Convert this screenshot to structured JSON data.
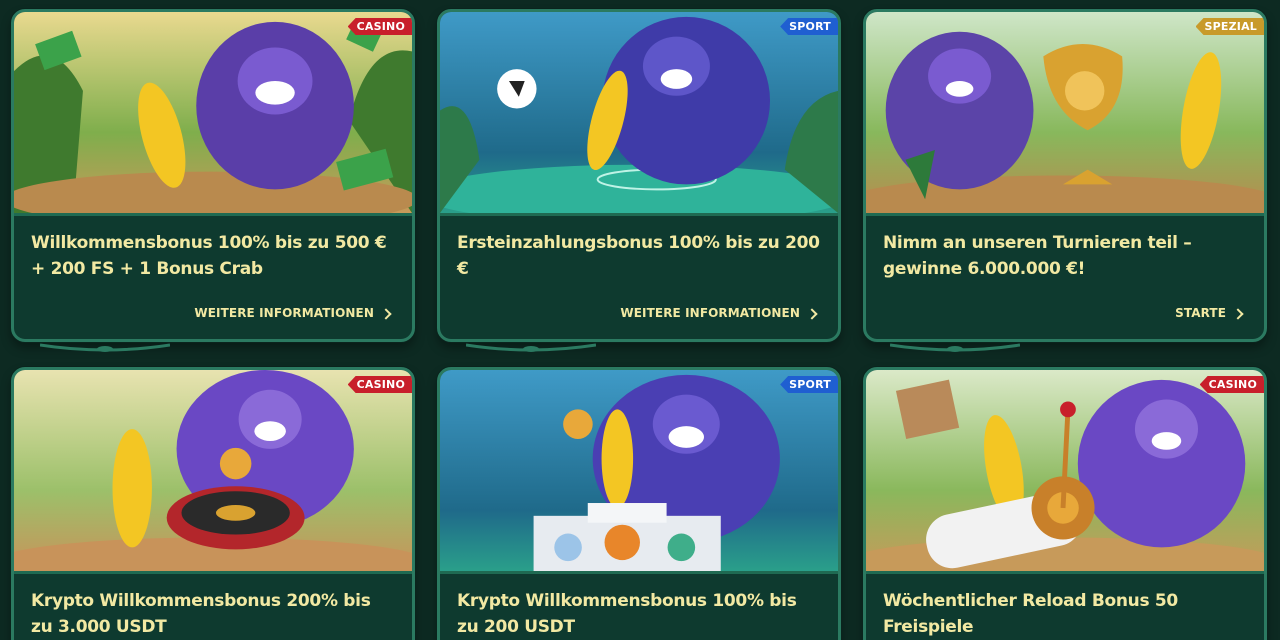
{
  "colors": {
    "background": "#0d2a22",
    "card": "#0e3a2f",
    "card_border": "#2b7a61",
    "title_text": "#f2e9a3",
    "badge_casino": "#c81f2b",
    "badge_sport": "#1f5fd1",
    "badge_spezial": "#c89a2a"
  },
  "cards": [
    {
      "badge": "CASINO",
      "badge_type": "casino",
      "image": "gorilla-banana-money-illustration",
      "title": "Willkommensbonus 100% bis zu 500 € + 200 FS + 1 Bonus Crab",
      "cta": "WEITERE INFORMATIONEN"
    },
    {
      "badge": "SPORT",
      "badge_type": "sport",
      "image": "gorilla-banana-soccer-illustration",
      "title": "Ersteinzahlungsbonus 100% bis zu 200 €",
      "cta": "WEITERE INFORMATIONEN"
    },
    {
      "badge": "SPEZIAL",
      "badge_type": "spezial",
      "image": "gorilla-banana-trophy-illustration",
      "title": "Nimm an unseren Turnieren teil – gewinne 6.000.000 €!",
      "cta": "STARTE"
    },
    {
      "badge": "CASINO",
      "badge_type": "casino",
      "image": "gorilla-banana-roulette-illustration",
      "title": "Krypto Willkommensbonus 200% bis zu 3.000 USDT"
    },
    {
      "badge": "SPORT",
      "badge_type": "sport",
      "image": "gorilla-banana-crypto-podium-illustration",
      "title": "Krypto Willkommensbonus 100% bis zu 200 USDT"
    },
    {
      "badge": "CASINO",
      "badge_type": "casino",
      "image": "gorilla-banana-slot-reel-illustration",
      "title": "Wöchentlicher Reload Bonus 50 Freispiele"
    }
  ]
}
